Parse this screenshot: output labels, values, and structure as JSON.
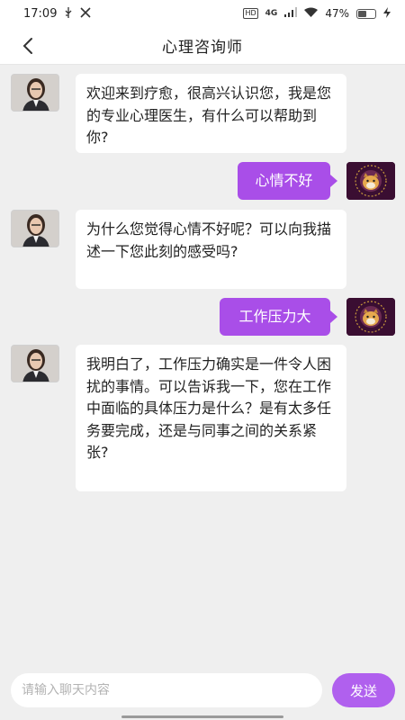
{
  "status_bar": {
    "time": "17:09",
    "usb_icon": "usb-icon",
    "tools_icon": "tools-icon",
    "hd_badge": "HD",
    "network": "4G",
    "battery_percent": "47%"
  },
  "header": {
    "title": "心理咨询师",
    "back_icon": "chevron-left-icon"
  },
  "messages": [
    {
      "sender": "doctor",
      "text": "欢迎来到疗愈，很高兴认识您，我是您的专业心理医生，有什么可以帮助到你?"
    },
    {
      "sender": "user",
      "text": "心情不好"
    },
    {
      "sender": "doctor",
      "text": "为什么您觉得心情不好呢？可以向我描述一下您此刻的感受吗?"
    },
    {
      "sender": "user",
      "text": "工作压力大"
    },
    {
      "sender": "doctor",
      "text": "我明白了，工作压力确实是一件令人困扰的事情。可以告诉我一下，您在工作中面临的具体压力是什么？是有太多任务要完成，还是与同事之间的关系紧张?"
    }
  ],
  "input": {
    "placeholder": "请输入聊天内容",
    "value": ""
  },
  "send_button": {
    "label": "发送"
  },
  "colors": {
    "accent": "#a94ee8",
    "background": "#efefef"
  }
}
